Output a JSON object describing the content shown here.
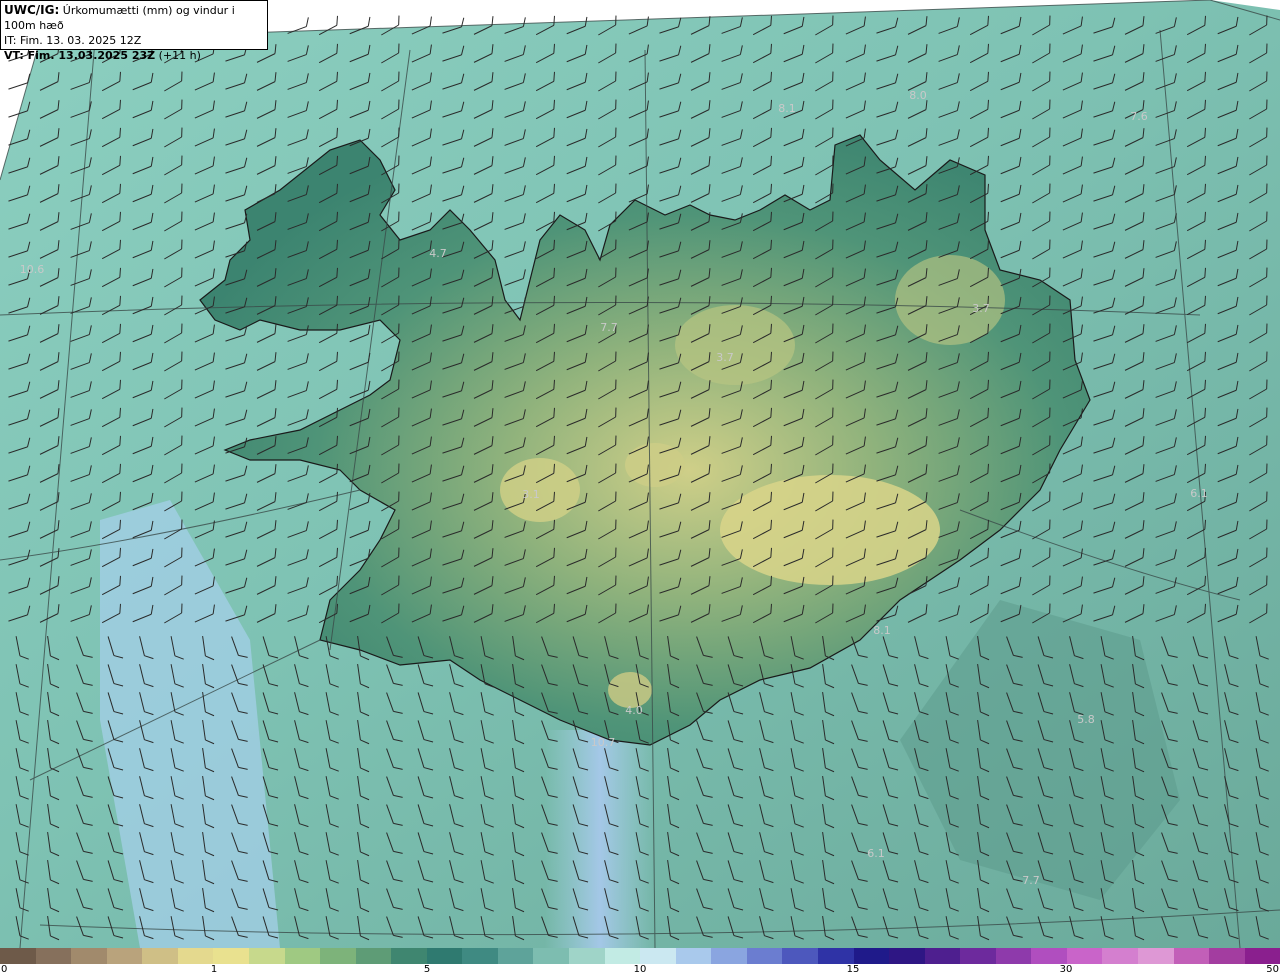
{
  "header": {
    "product": "UWC/IG:",
    "product_desc": "Úrkomumætti (mm) og vindur i 100m hæð",
    "init_line": "IT: Fim. 13. 03. 2025 12Z",
    "valid_label": "VT: Fim. 13.03.2025 23Z",
    "valid_offset": "(+11 h)"
  },
  "map": {
    "field": "precipitable water",
    "units": "mm",
    "wind_level": "100m",
    "labels": [
      {
        "text": "8.1"
      },
      {
        "text": "8.0"
      },
      {
        "text": "7.6"
      },
      {
        "text": "4.7"
      },
      {
        "text": "10.6"
      },
      {
        "text": "7.7"
      },
      {
        "text": "3.7"
      },
      {
        "text": "3.7"
      },
      {
        "text": "3.1"
      },
      {
        "text": "6.1"
      },
      {
        "text": "4.0"
      },
      {
        "text": "10.7"
      },
      {
        "text": "5.8"
      },
      {
        "text": "6.1"
      },
      {
        "text": "7.7"
      },
      {
        "text": "8.1"
      }
    ]
  },
  "colorbar": {
    "ticks": [
      "0",
      "1",
      "5",
      "10",
      "15",
      "30",
      "50"
    ],
    "colors": [
      "#6e5a49",
      "#86705c",
      "#a18a6c",
      "#b9a37c",
      "#cfbf86",
      "#e4d98e",
      "#e9e18f",
      "#c7d98c",
      "#9fc982",
      "#7db37a",
      "#5e9c76",
      "#3f8670",
      "#2f7a70",
      "#3f8a82",
      "#5ea39a",
      "#7dbdb0",
      "#9fd4c8",
      "#c2ebe4",
      "#cbe8f1",
      "#a9c9ec",
      "#8aa5e0",
      "#6b7dd0",
      "#4d58bd",
      "#2f33a6",
      "#1f1a8a",
      "#2e1684",
      "#4e1f8f",
      "#6d2a9d",
      "#8e3aab",
      "#b04ebf",
      "#c964c9",
      "#d47fcf",
      "#de98d5",
      "#c25fb8",
      "#a33da0",
      "#8a1f8e"
    ]
  },
  "colors": {
    "ocean": "#7fc4b6",
    "land_low": "#3f8a72",
    "land_high": "#cfd08a",
    "coast": "#1a1a1a",
    "grid": "#3a4a48",
    "barb": "#222222"
  }
}
